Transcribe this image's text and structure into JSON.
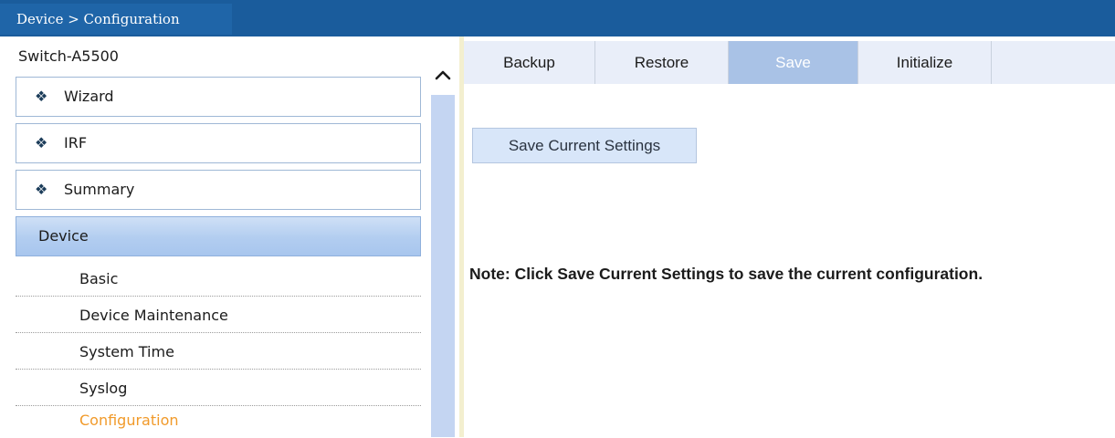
{
  "breadcrumb": "Device > Configuration",
  "nav": {
    "header": "Switch-A5500",
    "bullet_glyph": "❖",
    "sections": [
      {
        "label": "Wizard"
      },
      {
        "label": "IRF"
      },
      {
        "label": "Summary"
      }
    ],
    "active_section": "Device",
    "sub_items": [
      {
        "label": "Basic"
      },
      {
        "label": "Device Maintenance"
      },
      {
        "label": "System Time"
      },
      {
        "label": "Syslog"
      },
      {
        "label": "Configuration",
        "selected": true
      }
    ]
  },
  "tabs": [
    {
      "label": "Backup"
    },
    {
      "label": "Restore"
    },
    {
      "label": "Save",
      "active": true
    },
    {
      "label": "Initialize"
    }
  ],
  "main": {
    "save_button_label": "Save Current Settings",
    "note": "Note: Click Save Current Settings to save the current configuration."
  },
  "colors": {
    "title_bar": "#1a5c9c",
    "active_tab": "#a9c2e6",
    "selected_item": "#f19a2a",
    "scroll_thumb": "#c4d5f2"
  },
  "icons": {
    "bullet": "diamond-bullet-icon",
    "scroll_up": "chevron-up-icon"
  }
}
